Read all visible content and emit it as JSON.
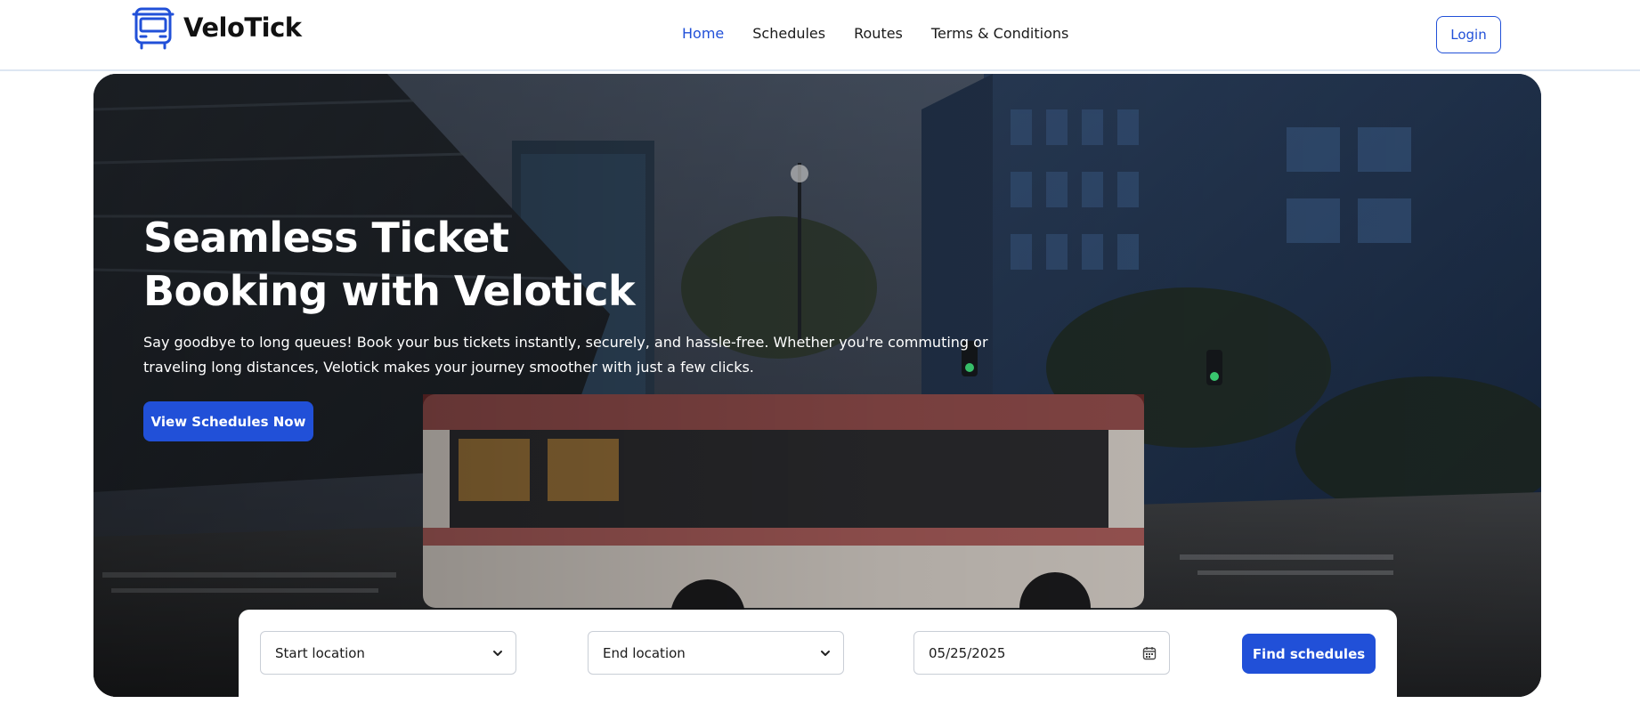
{
  "brand": {
    "name": "VeloTick",
    "logo_icon": "bus-icon"
  },
  "nav": {
    "items": [
      {
        "label": "Home",
        "active": true
      },
      {
        "label": "Schedules",
        "active": false
      },
      {
        "label": "Routes",
        "active": false
      },
      {
        "label": "Terms & Conditions",
        "active": false
      }
    ],
    "login_label": "Login"
  },
  "hero": {
    "title_line1": "Seamless Ticket",
    "title_line2": "Booking with Velotick",
    "description": "Say goodbye to long queues! Book your bus tickets instantly, securely, and hassle-free. Whether you're commuting or traveling long distances, Velotick makes your journey smoother with just a few clicks.",
    "cta_label": "View Schedules Now",
    "background": "photo of city street with moving bus at dusk"
  },
  "search": {
    "start_location": {
      "selected": "Start location",
      "icon": "chevron-down-icon"
    },
    "end_location": {
      "selected": "End location",
      "icon": "chevron-down-icon"
    },
    "date": {
      "value": "05/25/2025",
      "icon": "calendar-icon"
    },
    "submit_label": "Find schedules"
  },
  "colors": {
    "accent": "#2150d8",
    "text": "#1a1a1a",
    "header_border": "#dde6f2",
    "field_border": "#c9ced6"
  }
}
